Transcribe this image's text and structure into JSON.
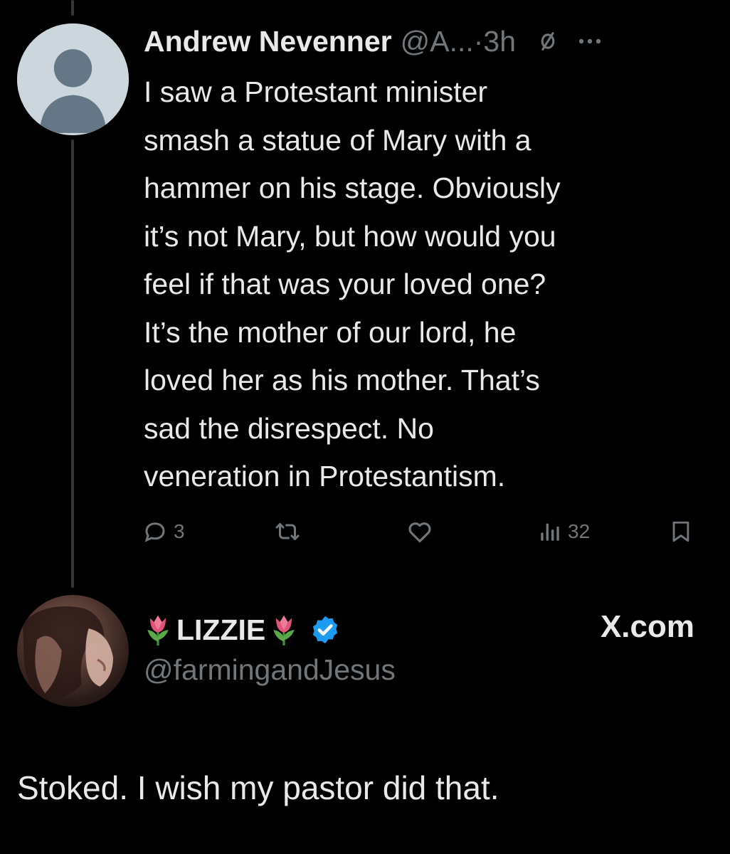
{
  "tweet": {
    "author_name": "Andrew Nevenner",
    "author_handle": "@A...",
    "time": "·3h",
    "body": "I saw a Protestant minister\nsmash a statue of Mary with a\nhammer on his stage. Obviously\nit’s not Mary, but how would you\nfeel if that was your loved one?\nIt’s the mother of our lord, he\nloved her as his mother. That’s\nsad the disrespect. No\nveneration in Protestantism.",
    "reply_count": "3",
    "view_count": "32"
  },
  "quote": {
    "author_name": "LIZZIE",
    "author_handle": "@farmingandJesus",
    "source": "X.com",
    "text": "Stoked. I wish my pastor did that."
  },
  "icons": {
    "header": [
      "mute-icon",
      "more-icon"
    ],
    "actions": [
      "reply-icon",
      "retweet-icon",
      "like-icon",
      "views-icon",
      "bookmark-icon"
    ],
    "badges": [
      "tulip-icon",
      "verified-badge-icon"
    ]
  },
  "colors": {
    "background": "#000000",
    "text": "#e7e9ea",
    "secondary": "#71767b",
    "verified": "#1d9bf0"
  }
}
